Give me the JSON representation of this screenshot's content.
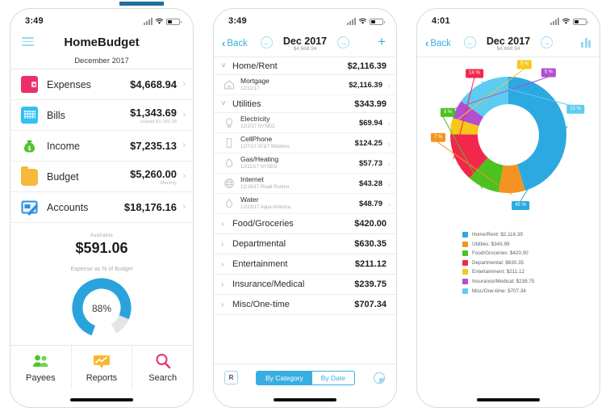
{
  "phone1": {
    "status": {
      "time": "3:49"
    },
    "nav": {
      "title": "HomeBudget",
      "menu_icon": "hamburger-icon"
    },
    "month_label": "December 2017",
    "rows": [
      {
        "icon": "wallet-icon",
        "label": "Expenses",
        "amount": "$4,668.94",
        "sub": ""
      },
      {
        "icon": "calendar-icon",
        "label": "Bills",
        "amount": "$1,343.69",
        "sub": "Unpaid $1,182.38"
      },
      {
        "icon": "moneybag-icon",
        "label": "Income",
        "amount": "$7,235.13",
        "sub": ""
      },
      {
        "icon": "folder-icon",
        "label": "Budget",
        "amount": "$5,260.00",
        "sub": "Monthly"
      },
      {
        "icon": "check-icon",
        "label": "Accounts",
        "amount": "$18,176.16",
        "sub": ""
      }
    ],
    "available": {
      "label": "Available",
      "amount": "$591.06"
    },
    "gauge": {
      "label": "Expense as % of Budget",
      "value": "88%",
      "percent": 88,
      "color": "#2aa3dd",
      "track": "#e2e4e6"
    },
    "tabs": [
      {
        "label": "Payees",
        "icon": "people-icon"
      },
      {
        "label": "Reports",
        "icon": "reports-icon"
      },
      {
        "label": "Search",
        "icon": "search-icon"
      }
    ]
  },
  "phone2": {
    "status": {
      "time": "3:49"
    },
    "nav": {
      "back": "Back",
      "month": "Dec 2017",
      "amount": "$4,668.94",
      "prev_icon": "arrow-left-icon",
      "next_icon": "arrow-right-icon",
      "add_icon": "plus-icon"
    },
    "groups": [
      {
        "expanded": true,
        "name": "Home/Rent",
        "total": "$2,116.39",
        "items": [
          {
            "icon": "home-icon",
            "name": "Mortgage",
            "meta": "12/12/17",
            "amount": "$2,116.39"
          }
        ]
      },
      {
        "expanded": true,
        "name": "Utilities",
        "total": "$343.99",
        "items": [
          {
            "icon": "bulb-icon",
            "name": "Electricity",
            "meta": "12/2/17 NYSEG",
            "amount": "$69.94"
          },
          {
            "icon": "phone-icon",
            "name": "CellPhone",
            "meta": "12/7/17 AT&T Wireless",
            "amount": "$124.25"
          },
          {
            "icon": "flame-icon",
            "name": "Gas/Heating",
            "meta": "12/11/17 NYSEG",
            "amount": "$57.73"
          },
          {
            "icon": "globe-icon",
            "name": "Internet",
            "meta": "12/16/17 Road Runner",
            "amount": "$43.28"
          },
          {
            "icon": "drop-icon",
            "name": "Water",
            "meta": "12/23/17 Aqua America",
            "amount": "$48.79"
          }
        ]
      },
      {
        "expanded": false,
        "name": "Food/Groceries",
        "total": "$420.00",
        "items": []
      },
      {
        "expanded": false,
        "name": "Departmental",
        "total": "$630.35",
        "items": []
      },
      {
        "expanded": false,
        "name": "Entertainment",
        "total": "$211.12",
        "items": []
      },
      {
        "expanded": false,
        "name": "Insurance/Medical",
        "total": "$239.75",
        "items": []
      },
      {
        "expanded": false,
        "name": "Misc/One-time",
        "total": "$707.34",
        "items": []
      }
    ],
    "bottom": {
      "r_button": "R",
      "segments": [
        {
          "label": "By Category",
          "selected": true
        },
        {
          "label": "By Date",
          "selected": false
        }
      ],
      "pie_icon": "pie-chart-icon"
    }
  },
  "phone3": {
    "status": {
      "time": "4:01"
    },
    "nav": {
      "back": "Back",
      "month": "Dec 2017",
      "amount": "$4,668.94",
      "prev_icon": "arrow-left-icon",
      "next_icon": "arrow-right-icon",
      "chart_icon": "bar-chart-icon"
    }
  },
  "chart_data": {
    "type": "pie",
    "title": "Dec 2017",
    "subtitle": "$4,668.94",
    "donut": true,
    "legend_position": "below",
    "categories": [
      "Home/Rent",
      "Utilities",
      "Food/Groceries",
      "Departmental",
      "Entertainment",
      "Insurance/Medical",
      "Misc/One-time"
    ],
    "values": [
      2116.39,
      343.99,
      420.0,
      630.35,
      211.12,
      239.75,
      707.34
    ],
    "percent_labels": [
      "45 %",
      "7 %",
      "9 %",
      "14 %",
      "5 %",
      "5 %",
      "15 %"
    ],
    "colors": [
      "#2ba9e0",
      "#f59322",
      "#4cc120",
      "#f2274c",
      "#f7c71b",
      "#b14fd0",
      "#5ecbf0"
    ],
    "legend_entries": [
      {
        "label": "Home/Rent: $2,116.39",
        "color": "#2ba9e0"
      },
      {
        "label": "Utilities: $343.99",
        "color": "#f59322"
      },
      {
        "label": "Food/Groceries: $420.00",
        "color": "#4cc120"
      },
      {
        "label": "Departmental: $630.35",
        "color": "#f2274c"
      },
      {
        "label": "Entertainment: $211.12",
        "color": "#f7c71b"
      },
      {
        "label": "Insurance/Medical: $239.75",
        "color": "#b14fd0"
      },
      {
        "label": "Misc/One-time: $707.34",
        "color": "#5ecbf0"
      }
    ]
  }
}
